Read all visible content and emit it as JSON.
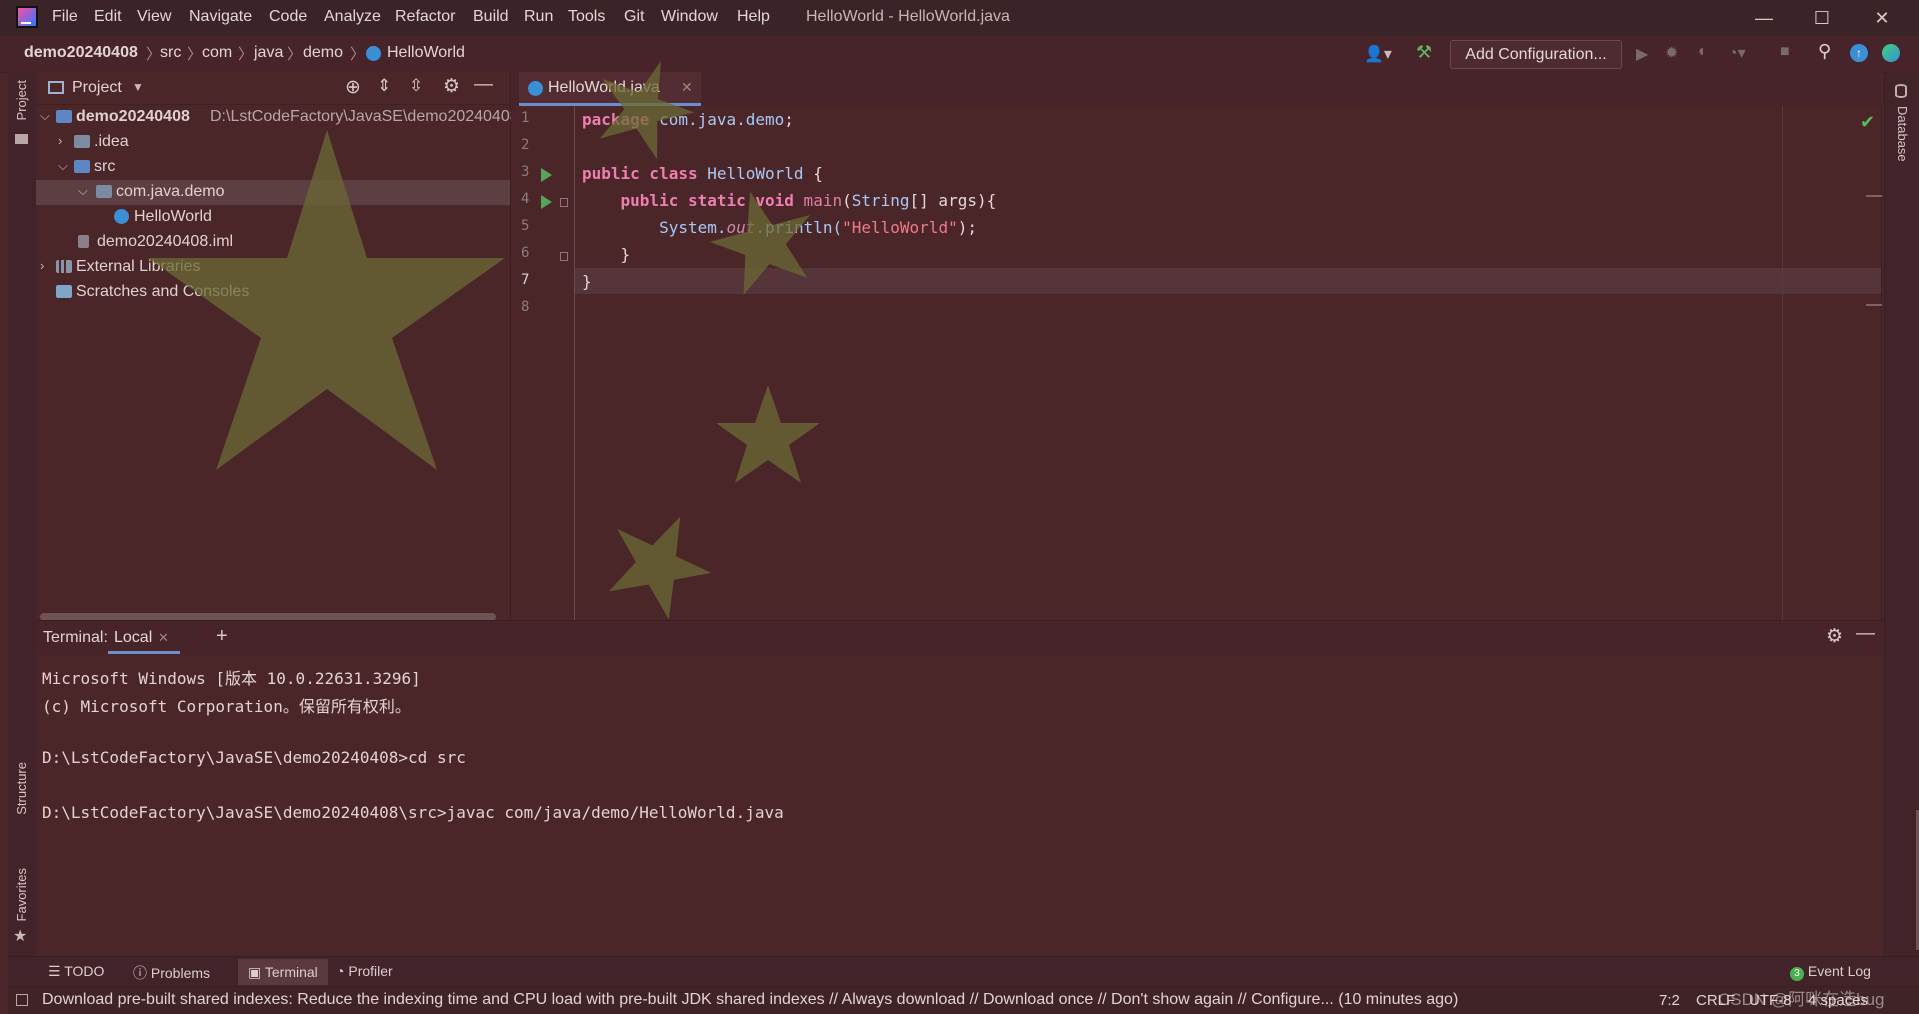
{
  "window": {
    "title": "HelloWorld - HelloWorld.java",
    "minimize_glyph": "—",
    "maximize_glyph": "☐",
    "close_glyph": "✕"
  },
  "menu": [
    "File",
    "Edit",
    "View",
    "Navigate",
    "Code",
    "Analyze",
    "Refactor",
    "Build",
    "Run",
    "Tools",
    "Git",
    "Window",
    "Help"
  ],
  "breadcrumbs": [
    "demo20240408",
    "src",
    "com",
    "java",
    "demo",
    "HelloWorld"
  ],
  "toolbar": {
    "add_configuration": "Add Configuration..."
  },
  "left_strip": {
    "project": "Project",
    "structure": "Structure",
    "favorites": "Favorites"
  },
  "right_strip": {
    "database": "Database"
  },
  "project": {
    "header": "Project",
    "tree": [
      {
        "label": "demo20240408",
        "path": "D:\\LstCodeFactory\\JavaSE\\demo20240408"
      },
      {
        "label": ".idea"
      },
      {
        "label": "src"
      },
      {
        "label": "com.java.demo"
      },
      {
        "label": "HelloWorld"
      },
      {
        "label": "demo20240408.iml"
      },
      {
        "label": "External Libraries"
      },
      {
        "label": "Scratches and Consoles"
      }
    ]
  },
  "editor": {
    "tab": "HelloWorld.java",
    "line_numbers": [
      "1",
      "2",
      "3",
      "4",
      "5",
      "6",
      "7",
      "8"
    ],
    "code": {
      "l1_kw": "package",
      "l1_pkg": " com.java.demo",
      "l1_end": ";",
      "l3_kw": "public class",
      "l3_cls": " HelloWorld",
      "l3_end": " {",
      "l4_kw": "    public static void",
      "l4_fn": " main",
      "l4_p1": "(",
      "l4_type": "String",
      "l4_rest": "[] args){",
      "l5_obj": "        System.",
      "l5_out": "out",
      "l5_call": ".println(",
      "l5_str": "\"HelloWorld\"",
      "l5_end": ");",
      "l6": "    }",
      "l7": "}"
    }
  },
  "terminal": {
    "label": "Terminal:",
    "tab": "Local",
    "lines": [
      "Microsoft Windows [版本 10.0.22631.3296]",
      "(c) Microsoft Corporation。保留所有权利。",
      "",
      "D:\\LstCodeFactory\\JavaSE\\demo20240408>cd src",
      "",
      "D:\\LstCodeFactory\\JavaSE\\demo20240408\\src>javac com/java/demo/HelloWorld.java"
    ]
  },
  "bottom_tabs": {
    "todo": "TODO",
    "problems": "Problems",
    "terminal": "Terminal",
    "profiler": "Profiler",
    "event_count": "3",
    "event_log": "Event Log"
  },
  "status": {
    "message": "Download pre-built shared indexes: Reduce the indexing time and CPU load with pre-built JDK shared indexes // Always download // Download once // Don't show again // Configure... (10 minutes ago)",
    "position": "7:2",
    "line_sep": "CRLF",
    "encoding": "UTF-8",
    "indent": "4 spaces",
    "watermark": "CSDN @阿咪在造bug"
  },
  "colors": {
    "background": "#4a262a",
    "star": "#6b6a35",
    "run_green": "#55a65b",
    "tab_underline": "#6a8fd0"
  }
}
